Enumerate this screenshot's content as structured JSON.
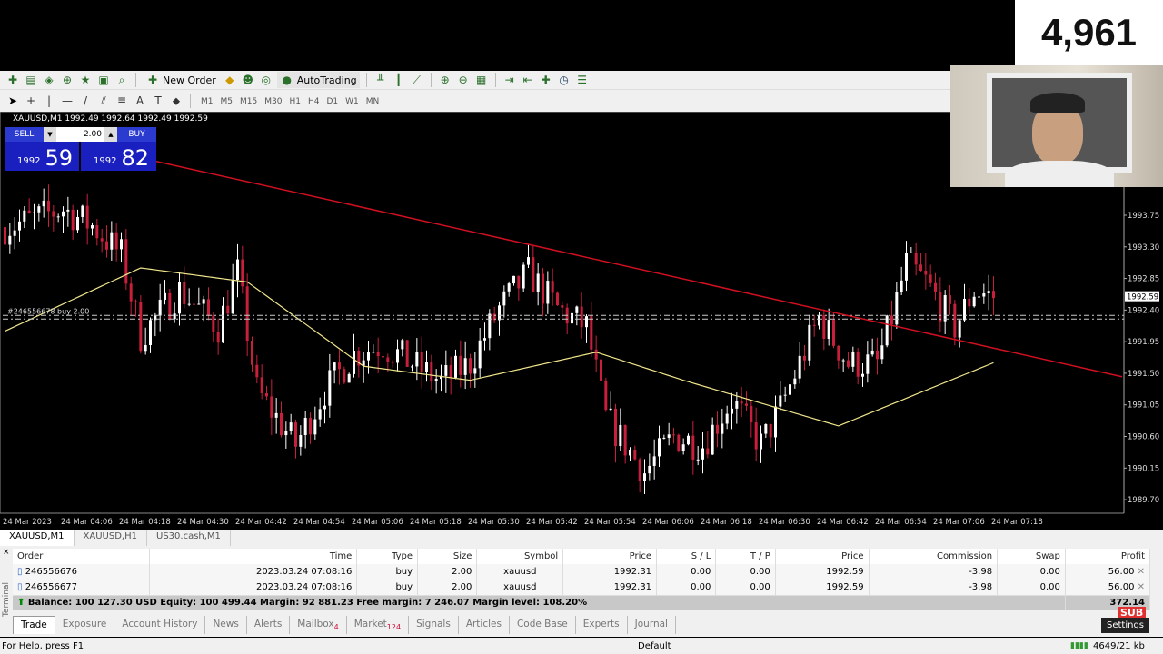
{
  "overlay": {
    "counter": "4,961"
  },
  "toolbar": {
    "new_order": "New Order",
    "autotrading": "AutoTrading",
    "timeframes": [
      "M1",
      "M5",
      "M15",
      "M30",
      "H1",
      "H4",
      "D1",
      "W1",
      "MN"
    ]
  },
  "chart": {
    "header": "XAUUSD,M1  1992.49 1992.64 1992.49 1992.59",
    "trade_panel": {
      "sell_label": "SELL",
      "buy_label": "BUY",
      "lot": "2.00",
      "sell_small": "1992",
      "sell_big": "59",
      "buy_small": "1992",
      "buy_big": "82"
    },
    "order_label": "#246556678 buy 2.00",
    "current_price": "1992.59",
    "colors": {
      "bull": "#ffffff",
      "bear": "#c8203c",
      "ma": "#f0e68c",
      "trendline": "#d01020",
      "background": "#000000"
    }
  },
  "chart_data": {
    "type": "candlestick",
    "symbol": "XAUUSD",
    "timeframe": "M1",
    "price_ticks": [
      "1993.75",
      "1993.30",
      "1992.85",
      "1992.40",
      "1991.95",
      "1991.50",
      "1991.05",
      "1990.60",
      "1990.15",
      "1989.70"
    ],
    "time_ticks": [
      "24 Mar 2023",
      "24 Mar 04:06",
      "24 Mar 04:18",
      "24 Mar 04:30",
      "24 Mar 04:42",
      "24 Mar 04:54",
      "24 Mar 05:06",
      "24 Mar 05:18",
      "24 Mar 05:30",
      "24 Mar 05:42",
      "24 Mar 05:54",
      "24 Mar 06:06",
      "24 Mar 06:18",
      "24 Mar 06:30",
      "24 Mar 06:42",
      "24 Mar 06:54",
      "24 Mar 07:06",
      "24 Mar 07:18"
    ],
    "ylim": [
      1989.51,
      1995.2
    ],
    "approx_closes": [
      [
        "03:54",
        1993.58
      ],
      [
        "04:00",
        1993.7
      ],
      [
        "04:06",
        1993.84
      ],
      [
        "04:12",
        1993.6
      ],
      [
        "04:18",
        1993.19
      ],
      [
        "04:22",
        1992.03
      ],
      [
        "04:30",
        1992.68
      ],
      [
        "04:38",
        1992.16
      ],
      [
        "04:42",
        1992.93
      ],
      [
        "04:46",
        1991.25
      ],
      [
        "04:54",
        1990.48
      ],
      [
        "05:00",
        1991.25
      ],
      [
        "05:06",
        1991.77
      ],
      [
        "05:12",
        1991.9
      ],
      [
        "05:18",
        1991.64
      ],
      [
        "05:24",
        1991.38
      ],
      [
        "05:30",
        1991.64
      ],
      [
        "05:36",
        1992.42
      ],
      [
        "05:42",
        1992.93
      ],
      [
        "05:48",
        1992.42
      ],
      [
        "05:54",
        1992.16
      ],
      [
        "05:58",
        1990.87
      ],
      [
        "06:06",
        1990.09
      ],
      [
        "06:12",
        1990.6
      ],
      [
        "06:18",
        1990.48
      ],
      [
        "06:24",
        1991.12
      ],
      [
        "06:30",
        1990.48
      ],
      [
        "06:34",
        1991.0
      ],
      [
        "06:42",
        1992.29
      ],
      [
        "06:48",
        1991.64
      ],
      [
        "06:54",
        1991.64
      ],
      [
        "06:57",
        1992.29
      ],
      [
        "07:00",
        1993.06
      ],
      [
        "07:04",
        1992.8
      ],
      [
        "07:10",
        1992.16
      ],
      [
        "07:14",
        1992.68
      ],
      [
        "07:18",
        1992.59
      ]
    ],
    "moving_average": [
      [
        "03:54",
        1992.1
      ],
      [
        "04:22",
        1993.0
      ],
      [
        "04:44",
        1992.8
      ],
      [
        "05:08",
        1991.6
      ],
      [
        "05:30",
        1991.4
      ],
      [
        "05:56",
        1991.8
      ],
      [
        "06:14",
        1991.4
      ],
      [
        "06:46",
        1990.75
      ],
      [
        "07:18",
        1991.65
      ]
    ],
    "trendline": [
      [
        "04:19",
        1994.62
      ],
      [
        "07:45",
        1991.45
      ]
    ],
    "order_levels": [
      1992.31,
      1992.31
    ]
  },
  "symbol_tabs": [
    "XAUUSD,M1",
    "XAUUSD,H1",
    "US30.cash,M1"
  ],
  "terminal": {
    "label": "Terminal",
    "columns": [
      "Order",
      "Time",
      "Type",
      "Size",
      "Symbol",
      "Price",
      "S / L",
      "T / P",
      "Price",
      "Commission",
      "Swap",
      "Profit"
    ],
    "rows": [
      [
        "246556676",
        "2023.03.24 07:08:16",
        "buy",
        "2.00",
        "xauusd",
        "1992.31",
        "0.00",
        "0.00",
        "1992.59",
        "-3.98",
        "0.00",
        "56.00"
      ],
      [
        "246556677",
        "2023.03.24 07:08:16",
        "buy",
        "2.00",
        "xauusd",
        "1992.31",
        "0.00",
        "0.00",
        "1992.59",
        "-3.98",
        "0.00",
        "56.00"
      ]
    ],
    "balance": "Balance: 100 127.30 USD  Equity: 100 499.44  Margin: 92 881.23  Free margin: 7 246.07  Margin level: 108.20%",
    "total_profit": "372.14",
    "tabs": [
      {
        "label": "Trade"
      },
      {
        "label": "Exposure"
      },
      {
        "label": "Account History"
      },
      {
        "label": "News"
      },
      {
        "label": "Alerts"
      },
      {
        "label": "Mailbox",
        "badge": "4"
      },
      {
        "label": "Market",
        "badge": "124"
      },
      {
        "label": "Signals"
      },
      {
        "label": "Articles"
      },
      {
        "label": "Code Base"
      },
      {
        "label": "Experts"
      },
      {
        "label": "Journal"
      }
    ],
    "settings_tooltip": "Settings",
    "sub_badge": "SUB"
  },
  "status": {
    "help": "For Help, press F1",
    "profile": "Default",
    "traffic": "4649/21 kb"
  }
}
